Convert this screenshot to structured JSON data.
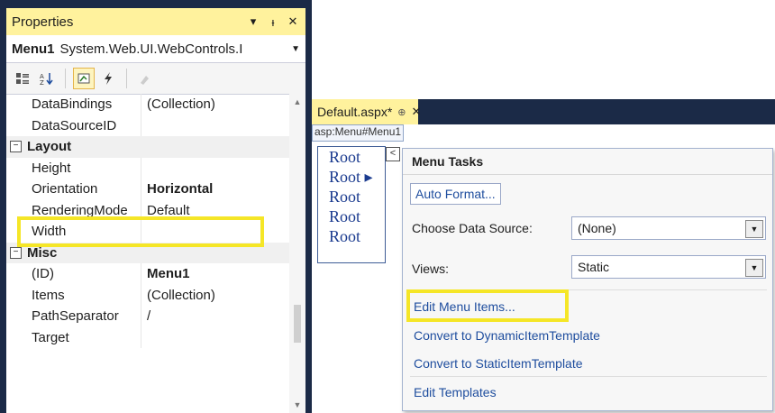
{
  "properties_panel": {
    "title": "Properties",
    "icons": [
      "dropdown-icon",
      "pin-icon",
      "close-icon"
    ],
    "object_name": "Menu1",
    "object_type": "System.Web.UI.WebControls.I",
    "toolbar": [
      "categorized-icon",
      "alphabetical-icon",
      "properties-icon",
      "events-icon",
      "property-pages-icon"
    ],
    "rows": [
      {
        "kind": "prop",
        "name": "DataBindings",
        "value": "(Collection)"
      },
      {
        "kind": "prop",
        "name": "DataSourceID",
        "value": ""
      },
      {
        "kind": "cat",
        "name": "Layout",
        "toggle": "⊟"
      },
      {
        "kind": "prop",
        "name": "Height",
        "value": ""
      },
      {
        "kind": "prop",
        "name": "Orientation",
        "value": "Horizontal",
        "bold": true
      },
      {
        "kind": "prop",
        "name": "RenderingMode",
        "value": "Default"
      },
      {
        "kind": "prop",
        "name": "Width",
        "value": ""
      },
      {
        "kind": "cat",
        "name": "Misc",
        "toggle": "⊟"
      },
      {
        "kind": "prop",
        "name": "(ID)",
        "value": "Menu1",
        "bold": true
      },
      {
        "kind": "prop",
        "name": "Items",
        "value": "(Collection)"
      },
      {
        "kind": "prop",
        "name": "PathSeparator",
        "value": "/"
      },
      {
        "kind": "prop",
        "name": "Target",
        "value": ""
      }
    ]
  },
  "designer": {
    "tab_label": "Default.aspx*",
    "breadcrumb": "asp:Menu#Menu1",
    "menu_items": [
      "Root",
      "Root ▸",
      "Root",
      "Root",
      "Root"
    ],
    "smart_tag": "<",
    "tasks": {
      "title": "Menu Tasks",
      "auto_format": "Auto Format...",
      "data_source_label": "Choose Data Source:",
      "data_source_value": "(None)",
      "views_label": "Views:",
      "views_value": "Static",
      "links": [
        "Edit Menu Items...",
        "Convert to DynamicItemTemplate",
        "Convert to StaticItemTemplate",
        "Edit Templates"
      ]
    }
  },
  "colors": {
    "vs_dark": "#1b2a47",
    "active_title": "#fff29d",
    "highlight": "#f5e627",
    "link": "#1e4d9e"
  }
}
